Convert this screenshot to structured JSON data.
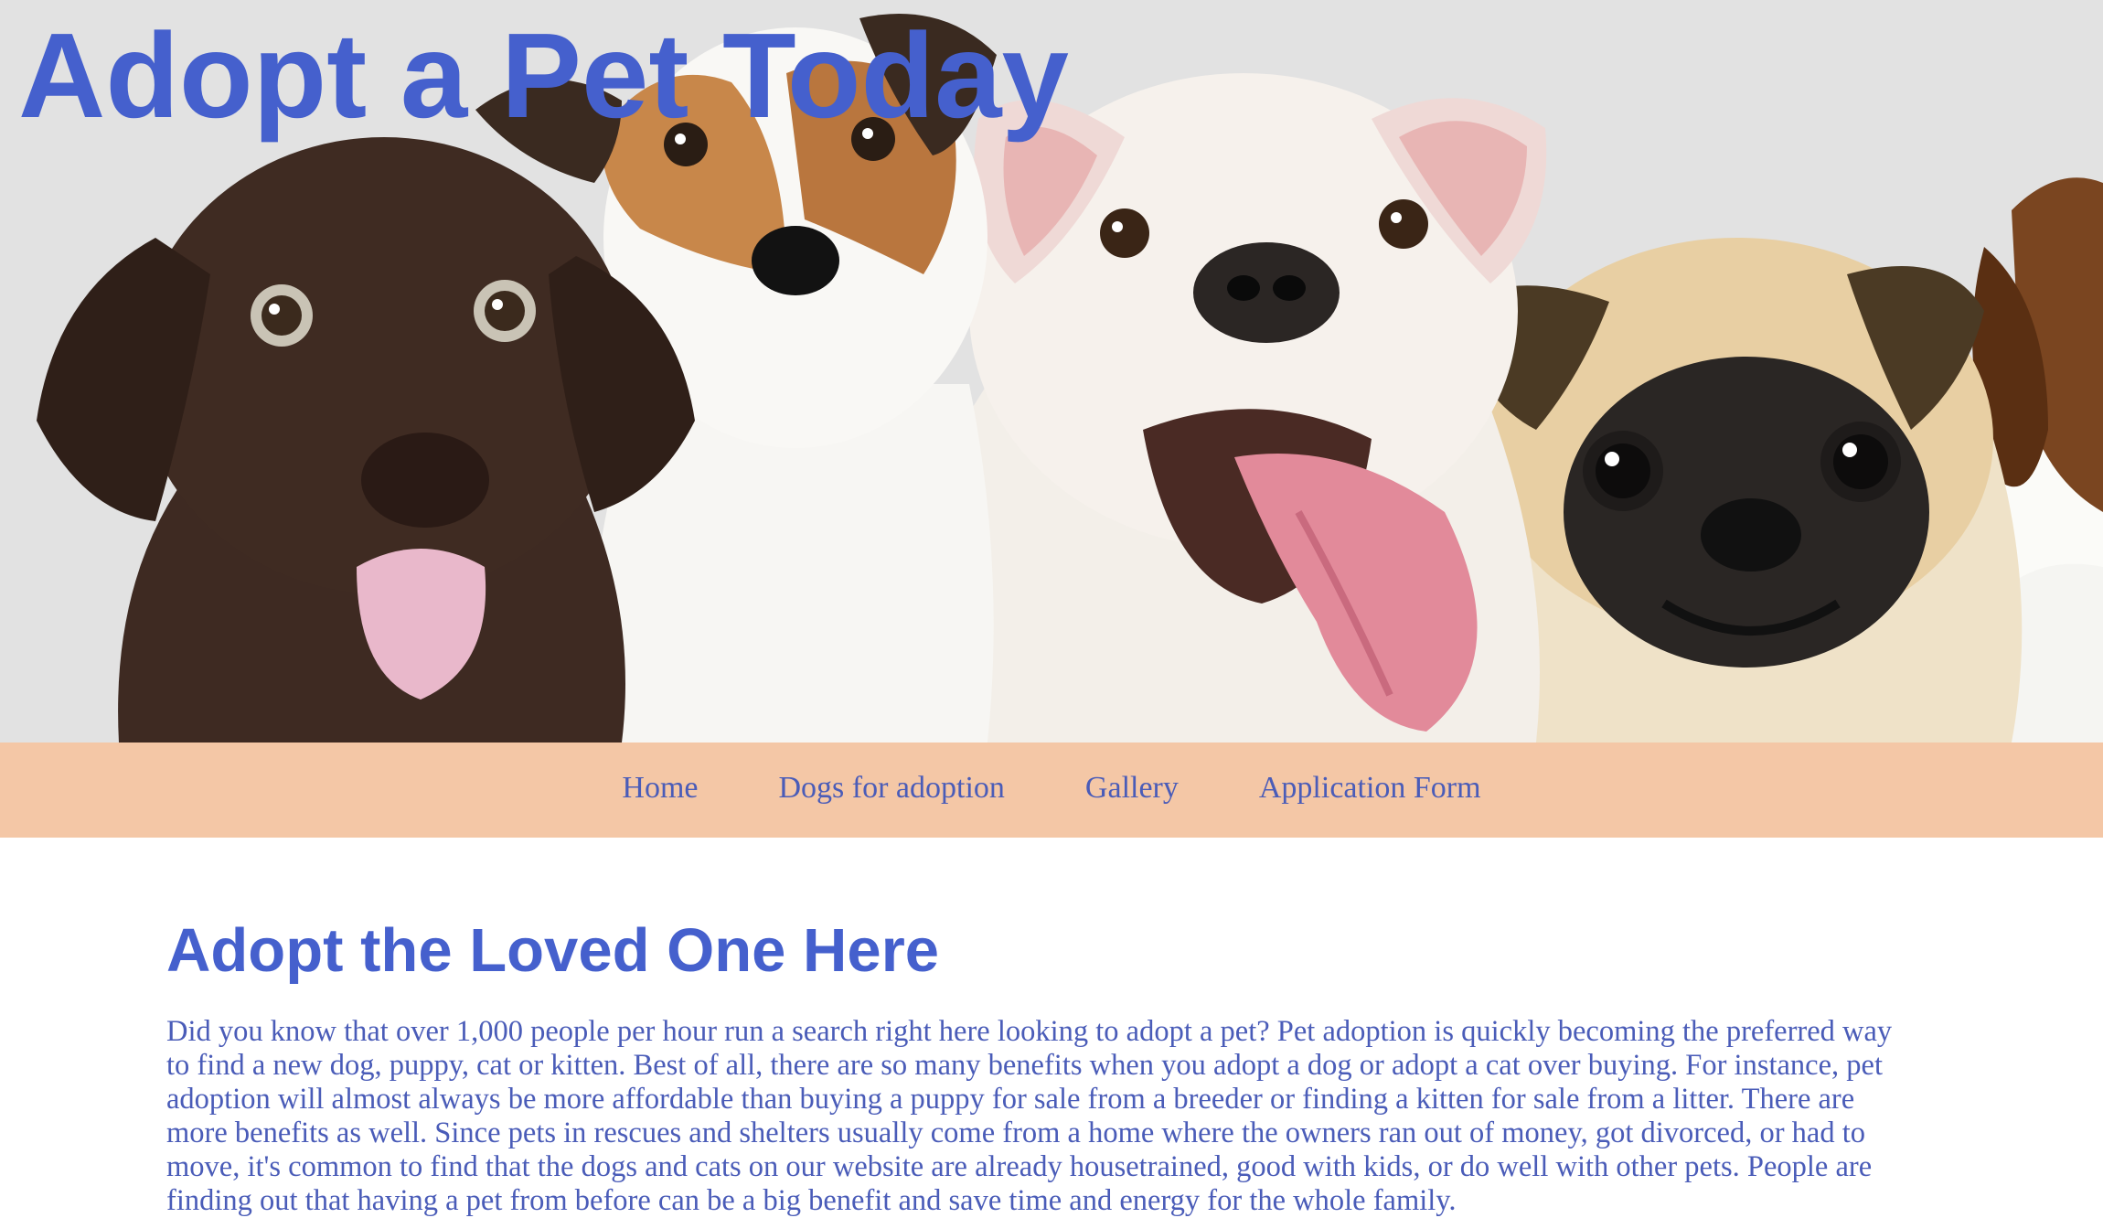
{
  "hero": {
    "title": "Adopt a Pet Today",
    "image_alt": "five puppies: chocolate lab, jack russell terrier, bulldog, pug, beagle"
  },
  "nav": {
    "items": [
      "Home",
      "Dogs for adoption",
      "Gallery",
      "Application Form"
    ]
  },
  "main": {
    "heading": "Adopt the Loved One Here",
    "body": "Did you know that over 1,000 people per hour run a search right here looking to adopt a pet? Pet adoption is quickly becoming the preferred way to find a new dog, puppy, cat or kitten. Best of all, there are so many benefits when you adopt a dog or adopt a cat over buying. For instance, pet adoption will almost always be more affordable than buying a puppy for sale from a breeder or finding a kitten for sale from a litter. There are more benefits as well. Since pets in rescues and shelters usually come from a home where the owners ran out of money, got divorced, or had to move, it's common to find that the dogs and cats on our website are already housetrained, good with kids, or do well with other pets. People are finding out that having a pet from before can be a big benefit and save time and energy for the whole family."
  },
  "colors": {
    "title_blue": "#4560cd",
    "text_blue": "#4a5cb8",
    "nav_bg": "#f4c7a6",
    "hero_bg": "#e2e2e2"
  }
}
